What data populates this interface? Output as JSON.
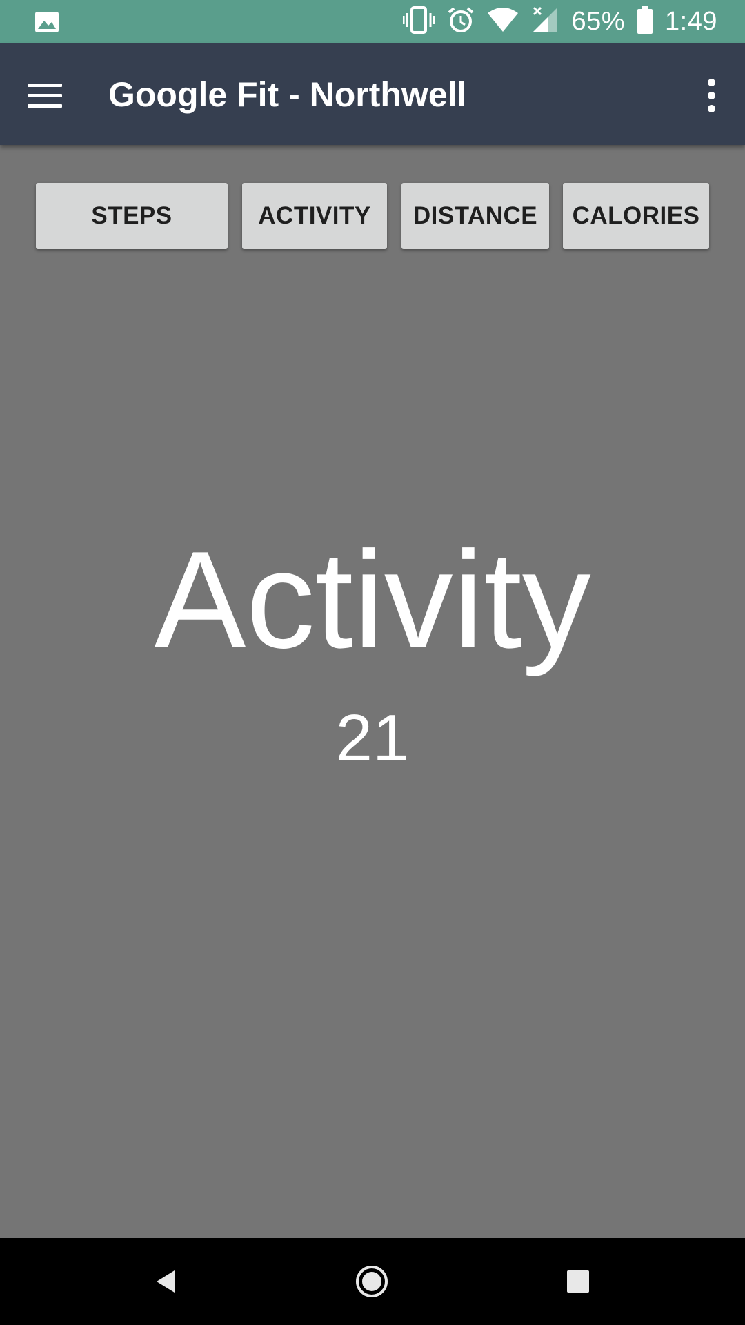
{
  "status_bar": {
    "battery_percent": "65%",
    "time": "1:49",
    "icons": [
      "image-icon",
      "vibrate-icon",
      "alarm-icon",
      "wifi-icon",
      "signal-icon",
      "battery-icon"
    ]
  },
  "app_bar": {
    "title": "Google Fit - Northwell",
    "icons": [
      "menu-icon",
      "overflow-menu-icon"
    ]
  },
  "tabs": [
    {
      "label": "STEPS"
    },
    {
      "label": "ACTIVITY"
    },
    {
      "label": "DISTANCE"
    },
    {
      "label": "CALORIES"
    }
  ],
  "metric": {
    "title": "Activity",
    "value": "21"
  },
  "nav_bar": {
    "icons": [
      "back-icon",
      "home-icon",
      "recents-icon"
    ]
  },
  "colors": {
    "status_bar": "#5a9e8c",
    "app_bar": "#363f50",
    "background": "#757575",
    "button": "#d6d7d7",
    "nav_bar": "#000000"
  }
}
